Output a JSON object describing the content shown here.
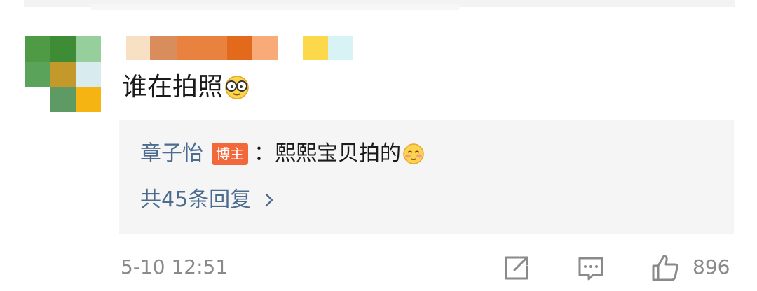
{
  "comment": {
    "text": "谁在拍照",
    "emoji": "glasses-face-icon",
    "timestamp": "5-10 12:51",
    "like_count": "896"
  },
  "reply": {
    "author": "章子怡",
    "badge": "博主",
    "colon": "：",
    "text": "熙熙宝贝拍的",
    "emoji": "blush-face-icon"
  },
  "replies_link": {
    "label": "共45条回复"
  },
  "actions": {
    "share": "share-icon",
    "comment": "comment-icon",
    "like": "thumbs-up-icon"
  },
  "colors": {
    "link": "#4d6a8f",
    "badge": "#f2683a",
    "text": "#1a1a1a",
    "meta": "#8a8a8a",
    "reply_bg": "#f5f5f5"
  }
}
